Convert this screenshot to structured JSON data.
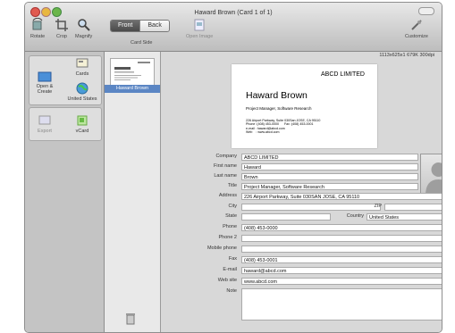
{
  "window": {
    "title": "Haward Brown (Card 1 of 1)"
  },
  "toolbar": {
    "rotate": "Rotate",
    "crop": "Crop",
    "magnify": "Magnify",
    "front": "Front",
    "back": "Back",
    "card_side": "Card Side",
    "open_image": "Open Image",
    "customize": "Customize"
  },
  "sidebar": {
    "open_create": "Open & Create",
    "cards": "Cards",
    "united_states": "United States",
    "export": "Export",
    "vcard": "vCard"
  },
  "card_list": {
    "selected": "Haward Brown"
  },
  "image_info": "1113x625x1  679K  300dpi",
  "business_card": {
    "company": "ABCD LIMITED",
    "name": "Haward Brown",
    "role": "Project Manager, Software Research",
    "details": "226 Airport Parkway, Suite 030San JOSE, CA 95110\nPhone :(408) 453-0000      Fax :(408) 453-0001\ne-mail : haward@abcd.com\nWeb    : www.abcd.com"
  },
  "form": {
    "company_label": "Company",
    "company": "ABCD LIMITED",
    "first_name_label": "First name",
    "first_name": "Haward",
    "last_name_label": "Last name",
    "last_name": "Brown",
    "title_label": "Title",
    "title": "Project Manager, Software Research",
    "address_label": "Address",
    "address": "226 Airport Parkway, Suite 030SAN JOSE, CA 95110",
    "city_label": "City",
    "city": "",
    "zip_label": "ZIP",
    "zip": "",
    "state_label": "State",
    "state": "",
    "country_label": "Country",
    "country": "United States",
    "phone_label": "Phone",
    "phone": "(408) 453-0000",
    "phone2_label": "Phone 2",
    "phone2": "",
    "mobile_label": "Mobile phone",
    "mobile": "",
    "fax_label": "Fax",
    "fax": "(408) 453-0001",
    "email_label": "E-mail",
    "email": "haward@abcd.com",
    "web_label": "Web site",
    "web": "www.abcd.com",
    "note_label": "Note",
    "note": ""
  },
  "colors": {
    "selection": "#5b86c4",
    "window_bg": "#d6d6d6"
  }
}
